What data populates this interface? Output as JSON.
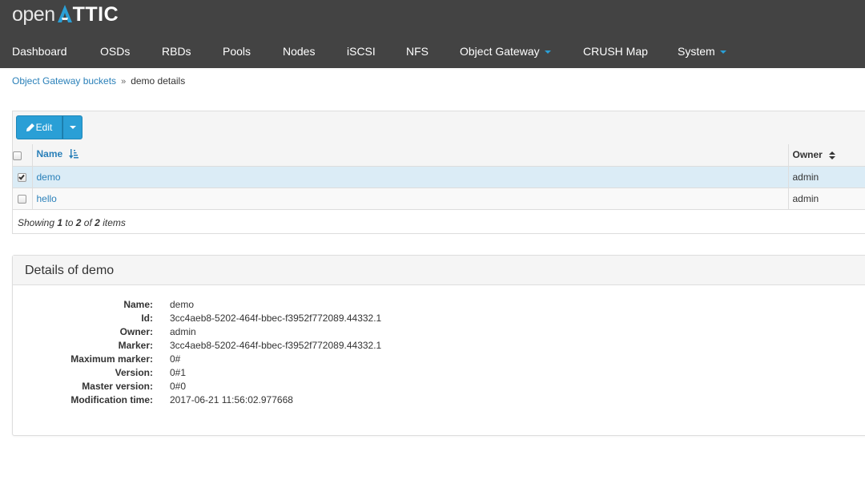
{
  "brand": {
    "prefix": "open",
    "suffix": "TTIC",
    "accent_color": "#2a9fd6"
  },
  "nav": {
    "items": [
      {
        "label": "Dashboard"
      },
      {
        "label": "OSDs"
      },
      {
        "label": "RBDs"
      },
      {
        "label": "Pools"
      },
      {
        "label": "Nodes"
      },
      {
        "label": "iSCSI"
      },
      {
        "label": "NFS"
      },
      {
        "label": "Object Gateway",
        "dropdown": true
      },
      {
        "label": "CRUSH Map"
      },
      {
        "label": "System",
        "dropdown": true
      }
    ]
  },
  "breadcrumb": {
    "parent": "Object Gateway buckets",
    "current": "demo details"
  },
  "toolbar": {
    "edit_label": "Edit",
    "edit_icon": "pencil-icon"
  },
  "grid": {
    "columns": {
      "name": "Name",
      "owner": "Owner"
    },
    "rows": [
      {
        "name": "demo",
        "owner": "admin",
        "checked": true
      },
      {
        "name": "hello",
        "owner": "admin",
        "checked": false
      }
    ],
    "footer": {
      "showing": "Showing",
      "from": "1",
      "to_word": "to",
      "to": "2",
      "of_word": "of",
      "total": "2",
      "items_word": "items"
    }
  },
  "details": {
    "title": "Details of demo",
    "fields": [
      {
        "key": "Name:",
        "value": "demo"
      },
      {
        "key": "Id:",
        "value": "3cc4aeb8-5202-464f-bbec-f3952f772089.44332.1"
      },
      {
        "key": "Owner:",
        "value": "admin"
      },
      {
        "key": "Marker:",
        "value": "3cc4aeb8-5202-464f-bbec-f3952f772089.44332.1"
      },
      {
        "key": "Maximum marker:",
        "value": "0#"
      },
      {
        "key": "Version:",
        "value": "0#1"
      },
      {
        "key": "Master version:",
        "value": "0#0"
      },
      {
        "key": "Modification time:",
        "value": "2017-06-21 11:56:02.977668"
      }
    ]
  }
}
